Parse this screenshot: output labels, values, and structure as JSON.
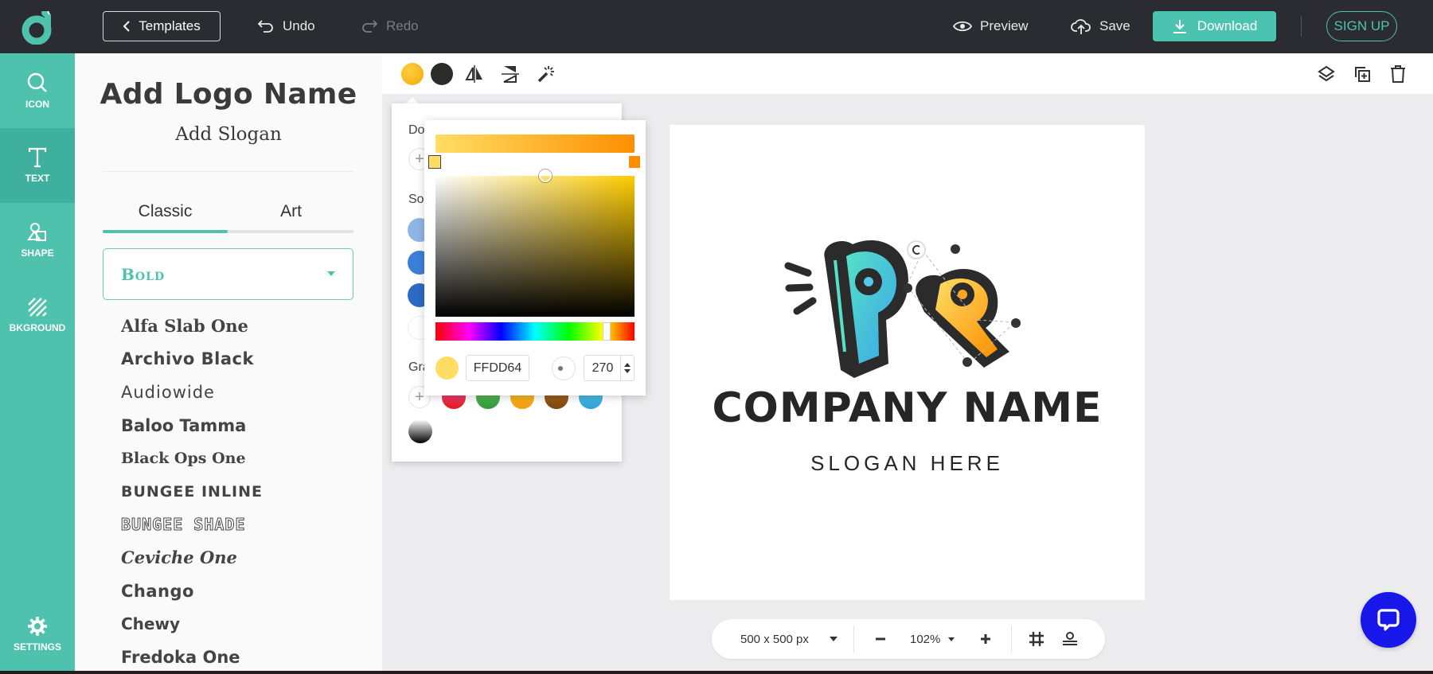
{
  "topbar": {
    "templates_label": "Templates",
    "undo_label": "Undo",
    "redo_label": "Redo",
    "preview_label": "Preview",
    "save_label": "Save",
    "download_label": "Download",
    "signup_label": "SIGN UP"
  },
  "rail": {
    "items": [
      {
        "label": "ICON",
        "icon": "search-icon"
      },
      {
        "label": "TEXT",
        "icon": "text-icon",
        "active": true
      },
      {
        "label": "SHAPE",
        "icon": "shape-icon"
      },
      {
        "label": "BKGROUND",
        "icon": "background-icon"
      },
      {
        "label": "SETTINGS",
        "icon": "gear-icon"
      }
    ]
  },
  "panel": {
    "logo_name": "Add Logo Name",
    "slogan": "Add Slogan",
    "tabs": [
      {
        "label": "Classic",
        "active": true
      },
      {
        "label": "Art",
        "active": false
      }
    ],
    "font_category": "Bold",
    "fonts": [
      "Alfa Slab One",
      "Archivo Black",
      "Audiowide",
      "Baloo Tamma",
      "Black Ops One",
      "BUNGEE INLINE",
      "BUNGEE SHADE",
      "Ceviche One",
      "Chango",
      "Chewy",
      "Fredoka One"
    ]
  },
  "canvas_toolbar": {
    "fill_color_1": "#f7b512",
    "fill_color_2": "#2a2c2a",
    "tools": [
      "flip-horizontal-icon",
      "flip-vertical-icon",
      "magic-wand-icon"
    ],
    "right_tools": [
      "layers-icon",
      "duplicate-icon",
      "trash-icon"
    ]
  },
  "color_popover": {
    "document_label": "Do",
    "solid_label": "So",
    "gradient_label": "Gra",
    "solid_swatches": [
      "#8fb5e6",
      "#3c7fd9",
      "#2c6ac4",
      "#ffffff"
    ],
    "gradient_swatches": [
      [
        "#ef4da0",
        "#e21b1b"
      ],
      [
        "#6cc25a",
        "#2f9a3a"
      ],
      [
        "#f8c62b",
        "#f59a0c"
      ],
      [
        "#b0701d",
        "#7d4510"
      ],
      [
        "#62c9ea",
        "#2ea2d8"
      ],
      [
        "#ffffff",
        "#000000"
      ]
    ]
  },
  "color_picker": {
    "gradient_start": "#ffdd64",
    "gradient_end": "#fc8f00",
    "hex_value": "FFDD64",
    "current_color": "#ffdd64",
    "angle": "270",
    "hue_position": 0.86,
    "saturation": 0.55,
    "brightness": 1.0
  },
  "artboard": {
    "company_name": "COMPANY NAME",
    "slogan": "SLOGAN HERE"
  },
  "zoombar": {
    "size_label": "500 x 500 px",
    "zoom_level": "102%"
  }
}
